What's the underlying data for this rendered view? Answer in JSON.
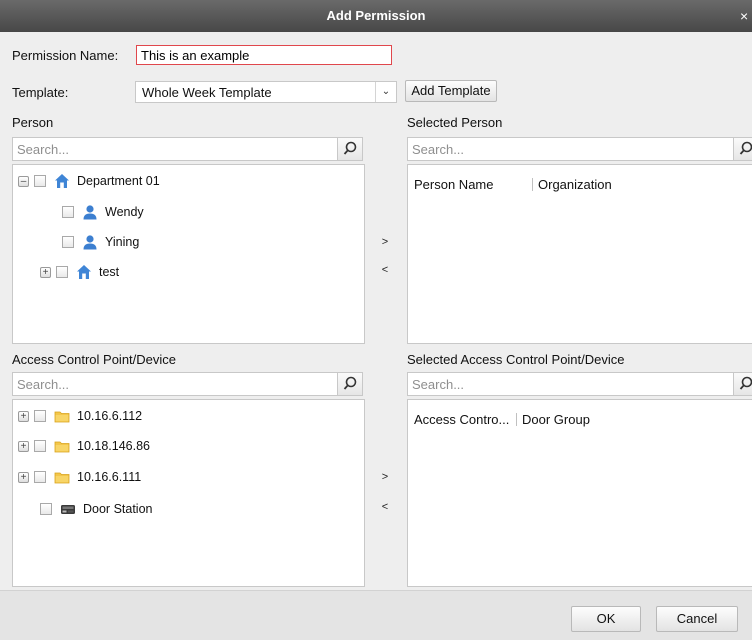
{
  "dialog": {
    "title": "Add Permission",
    "close_symbol": "×"
  },
  "form": {
    "permission_name_label": "Permission Name:",
    "permission_name_value": "This is an example",
    "template_label": "Template:",
    "template_value": "Whole Week Template",
    "add_template_label": "Add Template"
  },
  "person": {
    "label": "Person",
    "search_placeholder": "Search...",
    "tree": [
      "Department 01",
      "Wendy",
      "Yining",
      "test"
    ]
  },
  "selected_person": {
    "label": "Selected Person",
    "search_placeholder": "Search...",
    "columns": [
      "Person Name",
      "Organization"
    ]
  },
  "device": {
    "label": "Access Control Point/Device",
    "search_placeholder": "Search...",
    "tree": [
      "10.16.6.112",
      "10.18.146.86",
      "10.16.6.111",
      "Door Station"
    ]
  },
  "selected_device": {
    "label": "Selected Access Control Point/Device",
    "search_placeholder": "Search...",
    "columns": [
      "Access Contro...",
      "Door Group"
    ]
  },
  "transfer": {
    "add": ">",
    "remove": "<"
  },
  "footer": {
    "ok_label": "OK",
    "cancel_label": "Cancel"
  },
  "icons": {
    "department": "house-icon",
    "person": "person-icon",
    "device": "folder-icon",
    "door_station": "door-station-icon"
  },
  "colors": {
    "titlebar": "#474747",
    "input_border": "#e0474c",
    "dialog_bg": "#eeeeee"
  }
}
